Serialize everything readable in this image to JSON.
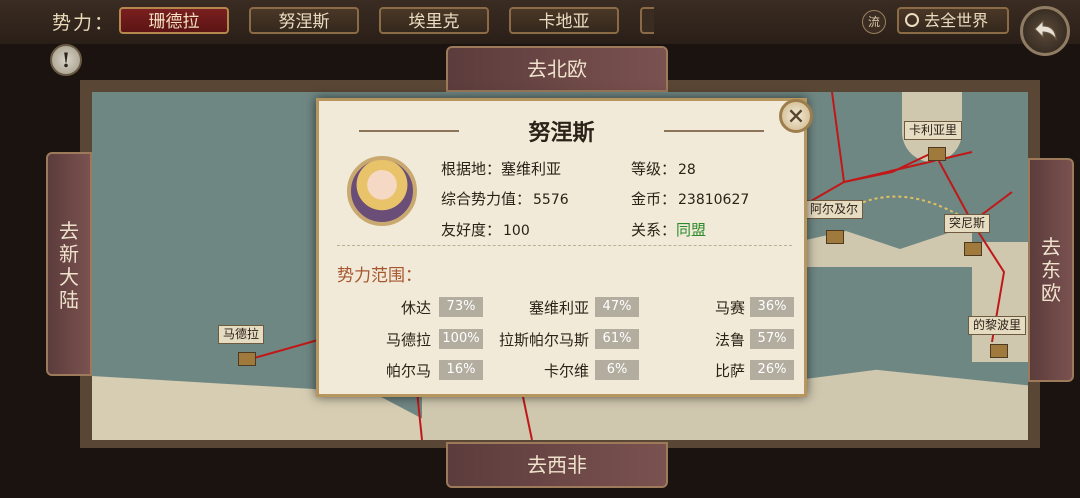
{
  "topbar": {
    "faction_label": "势力：",
    "tabs": [
      {
        "label": "珊德拉",
        "active": true
      },
      {
        "label": "努涅斯",
        "active": false
      },
      {
        "label": "埃里克",
        "active": false
      },
      {
        "label": "卡地亚",
        "active": false
      }
    ],
    "liu_label": "流",
    "world_label": "去全世界"
  },
  "nav": {
    "north": "去北欧",
    "west_africa": "去西非",
    "new_world": "去新大陆",
    "east_europe": "去东欧"
  },
  "map": {
    "cities": [
      "卡利亚里",
      "阿尔及尔",
      "突尼斯",
      "马德拉",
      "的黎波里"
    ]
  },
  "dialog": {
    "title": "努涅斯",
    "base_label": "根据地：",
    "base_value": "塞维利亚",
    "level_label": "等级：",
    "level_value": "28",
    "power_label": "综合势力值：",
    "power_value": "5576",
    "gold_label": "金币：",
    "gold_value": "23810627",
    "friend_label": "友好度：",
    "friend_value": "100",
    "relation_label": "关系：",
    "relation_value": "同盟",
    "range_title": "势力范围：",
    "territories": [
      {
        "name": "休达",
        "pct": "73%"
      },
      {
        "name": "塞维利亚",
        "pct": "47%"
      },
      {
        "name": "马赛",
        "pct": "36%"
      },
      {
        "name": "马德拉",
        "pct": "100%"
      },
      {
        "name": "拉斯帕尔马斯",
        "pct": "61%"
      },
      {
        "name": "法鲁",
        "pct": "57%"
      },
      {
        "name": "帕尔马",
        "pct": "16%"
      },
      {
        "name": "卡尔维",
        "pct": "6%"
      },
      {
        "name": "比萨",
        "pct": "26%"
      }
    ]
  },
  "colors": {
    "active_tab": "#7a1f1f",
    "relation_green": "#2b8a2b",
    "range_title": "#a8562f",
    "route_red": "#c01818"
  }
}
